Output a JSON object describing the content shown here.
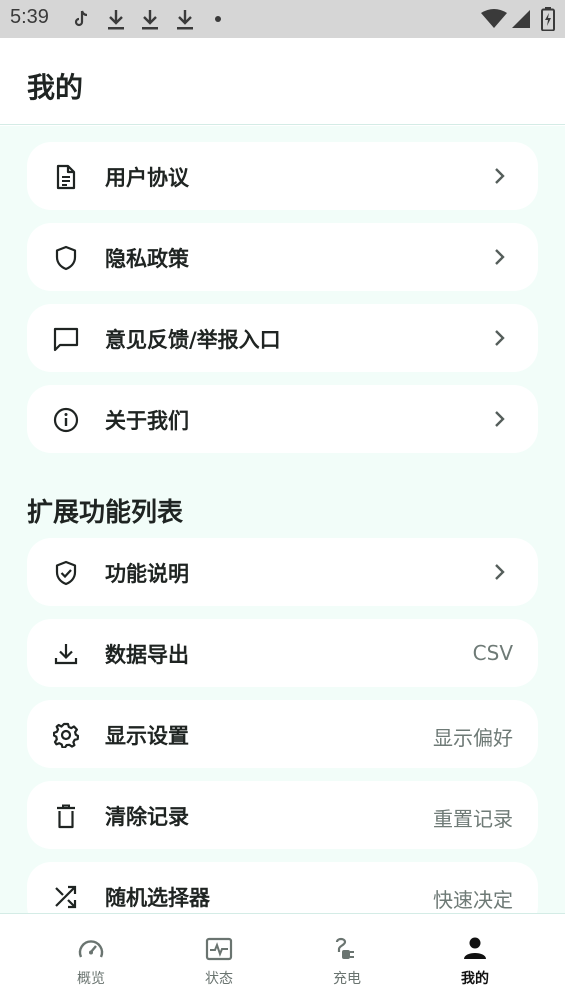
{
  "status_bar": {
    "time": "5:39"
  },
  "app_bar": {
    "title": "我的"
  },
  "menu_items": [
    {
      "label": "用户协议",
      "icon": "document-icon"
    },
    {
      "label": "隐私政策",
      "icon": "shield-icon"
    },
    {
      "label": "意见反馈/举报入口",
      "icon": "chat-bubble-icon"
    },
    {
      "label": "关于我们",
      "icon": "info-icon"
    }
  ],
  "section": {
    "title": "扩展功能列表"
  },
  "feature_items": [
    {
      "label": "功能说明",
      "icon": "shield-check-icon"
    },
    {
      "label": "数据导出",
      "icon": "download-icon",
      "value": "CSV"
    },
    {
      "label": "显示设置",
      "icon": "gear-icon",
      "value": "显示偏好"
    },
    {
      "label": "清除记录",
      "icon": "trash-icon",
      "value": "重置记录"
    },
    {
      "label": "随机选择器",
      "icon": "shuffle-icon",
      "value": "快速决定"
    }
  ],
  "bottom_nav": [
    {
      "label": "概览",
      "icon": "speedometer-icon"
    },
    {
      "label": "状态",
      "icon": "pulse-icon"
    },
    {
      "label": "充电",
      "icon": "charger-icon"
    },
    {
      "label": "我的",
      "icon": "person-icon",
      "active": true
    }
  ],
  "colors": {
    "accent_bg": "#f2fdf9",
    "card": "#ffffff",
    "status_bar": "#d6d6d6",
    "divider": "#d4ece6"
  }
}
